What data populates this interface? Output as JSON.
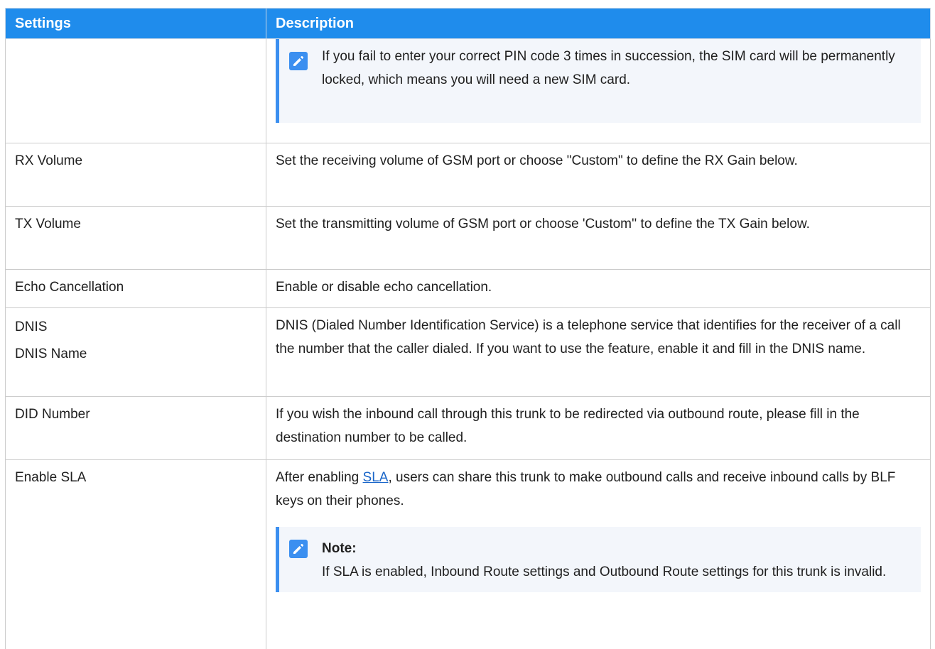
{
  "header": {
    "settings": "Settings",
    "description": "Description"
  },
  "rows": {
    "pin": {
      "note_text": "If you fail to enter your correct PIN code 3 times in succession, the SIM card will be permanently locked, which means you will need a new SIM card."
    },
    "rx": {
      "setting": "RX Volume",
      "desc": "Set the receiving volume of GSM port or choose \"Custom\" to define the RX Gain below."
    },
    "tx": {
      "setting": "TX Volume",
      "desc": "Set the transmitting volume of GSM port or choose 'Custom'' to define the TX Gain below."
    },
    "echo": {
      "setting": "Echo Cancellation",
      "desc": "Enable or disable echo cancellation."
    },
    "dnis": {
      "setting_1": "DNIS",
      "setting_2": "DNIS Name",
      "desc": "DNIS (Dialed Number Identification Service) is a telephone service that identifies for the receiver of a call the number that the caller dialed. If you want to use the feature, enable it and fill in the DNIS name."
    },
    "did": {
      "setting": "DID Number",
      "desc": "If you wish the inbound call through this trunk to be redirected via outbound route, please fill in the destination number to be called."
    },
    "sla": {
      "setting": "Enable SLA",
      "desc_prefix": "After enabling ",
      "desc_link": "SLA",
      "desc_suffix": ", users can share this trunk to make outbound calls and receive inbound calls by BLF keys on their phones.",
      "note_title": "Note:",
      "note_text": "If SLA is enabled, Inbound Route settings and Outbound Route settings for this trunk is invalid."
    }
  },
  "colors": {
    "header_bg": "#1f8cec",
    "note_accent": "#3b8ff0",
    "note_bg": "#f3f6fb",
    "link": "#1a66c9"
  },
  "icons": {
    "note": "pencil-edit-icon"
  }
}
